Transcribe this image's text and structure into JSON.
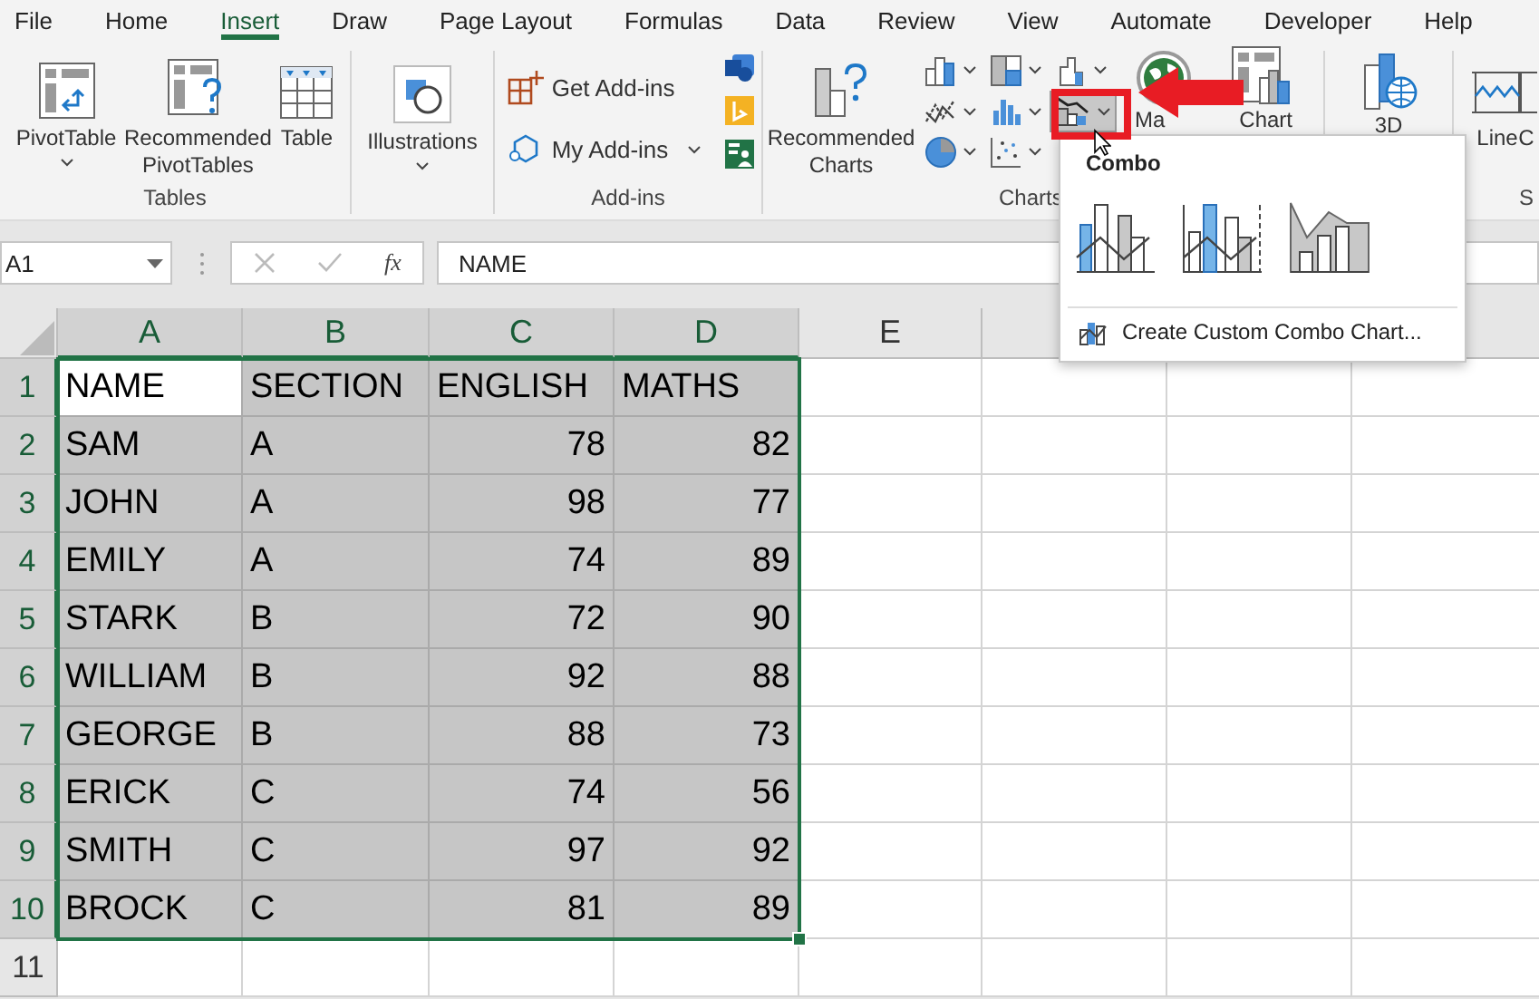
{
  "menu_tabs": [
    {
      "label": "File",
      "selected": false
    },
    {
      "label": "Home",
      "selected": false
    },
    {
      "label": "Insert",
      "selected": true
    },
    {
      "label": "Draw",
      "selected": false
    },
    {
      "label": "Page Layout",
      "selected": false
    },
    {
      "label": "Formulas",
      "selected": false
    },
    {
      "label": "Data",
      "selected": false
    },
    {
      "label": "Review",
      "selected": false
    },
    {
      "label": "View",
      "selected": false
    },
    {
      "label": "Automate",
      "selected": false
    },
    {
      "label": "Developer",
      "selected": false
    },
    {
      "label": "Help",
      "selected": false
    }
  ],
  "ribbon": {
    "groups": [
      {
        "kind": "large-row",
        "label": "Tables",
        "buttons": [
          {
            "kind": "pivot-table",
            "label": "PivotTable",
            "dropdown": true
          },
          {
            "kind": "recommended-pivot",
            "label": "Recommended PivotTables",
            "dropdown": false
          },
          {
            "kind": "table",
            "label": "Table",
            "dropdown": false
          }
        ]
      },
      {
        "kind": "large-row",
        "buttons": [
          {
            "kind": "illustrations",
            "label": "Illustrations",
            "dropdown": true
          }
        ]
      },
      {
        "kind": "addins",
        "label": "Add-ins",
        "buttons": [
          {
            "kind": "get-addins",
            "label": "Get Add-ins",
            "dropdown": false
          },
          {
            "kind": "my-addins",
            "label": "My Add-ins",
            "dropdown": true
          },
          {
            "kind": "visio-app"
          },
          {
            "kind": "bing-app"
          },
          {
            "kind": "people-app"
          }
        ]
      },
      {
        "kind": "charts",
        "label": "Charts",
        "buttons": [
          {
            "kind": "recommended-charts",
            "label": "Recommended Charts",
            "dropdown": false
          },
          {
            "kind": "column-chart",
            "selected": false
          },
          {
            "kind": "hierarchy-chart",
            "selected": false
          },
          {
            "kind": "waterfall-chart",
            "selected": false
          },
          {
            "kind": "line-chart",
            "selected": false
          },
          {
            "kind": "statistic-chart",
            "selected": false
          },
          {
            "kind": "combo-chart",
            "selected": true
          },
          {
            "kind": "pie-chart",
            "selected": false
          },
          {
            "kind": "scatter-chart",
            "selected": false
          },
          {
            "kind": "maps",
            "label": "Ma",
            "dropdown": false
          },
          {
            "kind": "pivot-chart",
            "label": "Chart",
            "dropdown": false
          }
        ]
      },
      {
        "kind": "large-row",
        "buttons": [
          {
            "kind": "map-3d",
            "label": "3D",
            "dropdown": false
          }
        ]
      },
      {
        "kind": "large-row",
        "label": "S",
        "buttons": [
          {
            "kind": "sparkline-line",
            "label": "Line",
            "dropdown": false
          },
          {
            "kind": "sparkline-column",
            "label": "C",
            "dropdown": false
          }
        ]
      }
    ]
  },
  "formula_bar": {
    "name_box": "A1",
    "function_label": "fx",
    "formula": "NAME"
  },
  "sheet": {
    "columns": [
      "A",
      "B",
      "C",
      "D",
      "E"
    ],
    "rows": [
      {
        "number": "1",
        "selected": true,
        "cells": [
          "NAME",
          "SECTION",
          "ENGLISH",
          "MATHS"
        ]
      },
      {
        "number": "2",
        "selected": true,
        "cells": [
          "SAM",
          "A",
          "78",
          "82"
        ]
      },
      {
        "number": "3",
        "selected": true,
        "cells": [
          "JOHN",
          "A",
          "98",
          "77"
        ]
      },
      {
        "number": "4",
        "selected": true,
        "cells": [
          "EMILY",
          "A",
          "74",
          "89"
        ]
      },
      {
        "number": "5",
        "selected": true,
        "cells": [
          "STARK",
          "B",
          "72",
          "90"
        ]
      },
      {
        "number": "6",
        "selected": true,
        "cells": [
          "WILLIAM",
          "B",
          "92",
          "88"
        ]
      },
      {
        "number": "7",
        "selected": true,
        "cells": [
          "GEORGE",
          "B",
          "88",
          "73"
        ]
      },
      {
        "number": "8",
        "selected": true,
        "cells": [
          "ERICK",
          "C",
          "74",
          "56"
        ]
      },
      {
        "number": "9",
        "selected": true,
        "cells": [
          "SMITH",
          "C",
          "97",
          "92"
        ]
      },
      {
        "number": "10",
        "selected": true,
        "cells": [
          "BROCK",
          "C",
          "81",
          "89"
        ]
      },
      {
        "number": "11",
        "selected": false
      }
    ]
  },
  "combo_menu": {
    "title": "Combo",
    "options": [
      {
        "kind": "clustered-column-line"
      },
      {
        "kind": "clustered-column-line-secondary"
      },
      {
        "kind": "stacked-area-column"
      }
    ],
    "footer": "Create Custom Combo Chart..."
  }
}
